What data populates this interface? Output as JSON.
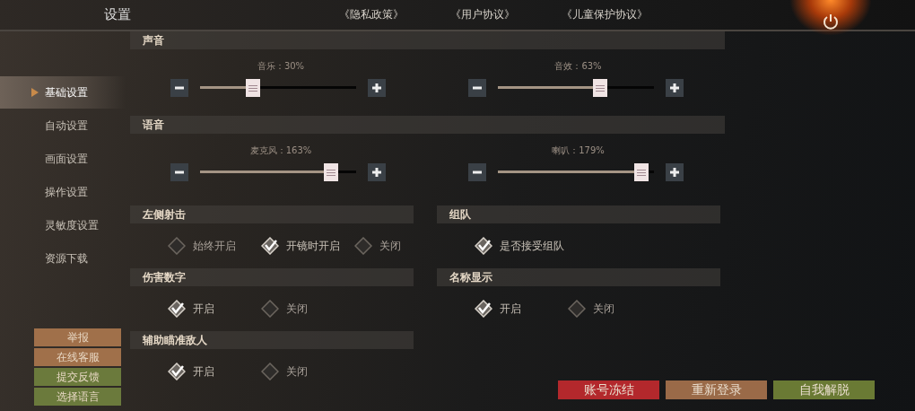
{
  "header": {
    "title": "设置",
    "links": [
      "《隐私政策》",
      "《用户协议》",
      "《儿童保护协议》"
    ]
  },
  "sidebar": {
    "items": [
      {
        "label": "基础设置",
        "selected": true
      },
      {
        "label": "自动设置",
        "selected": false
      },
      {
        "label": "画面设置",
        "selected": false
      },
      {
        "label": "操作设置",
        "selected": false
      },
      {
        "label": "灵敏度设置",
        "selected": false
      },
      {
        "label": "资源下载",
        "selected": false
      }
    ],
    "actions": [
      {
        "label": "举报",
        "color": "#a0704a"
      },
      {
        "label": "在线客服",
        "color": "#a0704a"
      },
      {
        "label": "提交反馈",
        "color": "#6b7a3c"
      },
      {
        "label": "选择语言",
        "color": "#6b7a3c"
      }
    ]
  },
  "slider_sections": [
    {
      "title": "声音",
      "sliders": [
        {
          "label": "音乐：30%",
          "level": 0.34
        },
        {
          "label": "音效：63%",
          "level": 0.66
        }
      ]
    },
    {
      "title": "语音",
      "sliders": [
        {
          "label": "麦克风：163%",
          "level": 0.84
        },
        {
          "label": "喇叭：179%",
          "level": 0.92
        }
      ]
    }
  ],
  "option_groups": [
    {
      "title": "左侧射击",
      "options": [
        {
          "label": "始终开启",
          "selected": false
        },
        {
          "label": "开镜时开启",
          "selected": true
        },
        {
          "label": "关闭",
          "selected": false
        }
      ]
    },
    {
      "title": "组队",
      "options": [
        {
          "label": "是否接受组队",
          "selected": true
        }
      ]
    },
    {
      "title": "伤害数字",
      "options": [
        {
          "label": "开启",
          "selected": true
        },
        {
          "label": "关闭",
          "selected": false
        }
      ]
    },
    {
      "title": "名称显示",
      "options": [
        {
          "label": "开启",
          "selected": true
        },
        {
          "label": "关闭",
          "selected": false
        }
      ]
    },
    {
      "title": "辅助瞄准敌人",
      "options": [
        {
          "label": "开启",
          "selected": true
        },
        {
          "label": "关闭",
          "selected": false
        }
      ]
    }
  ],
  "footer_buttons": [
    {
      "label": "账号冻结",
      "color": "#b3282c"
    },
    {
      "label": "重新登录",
      "color": "#9a6a48"
    },
    {
      "label": "自我解脱",
      "color": "#6a7a34"
    }
  ]
}
